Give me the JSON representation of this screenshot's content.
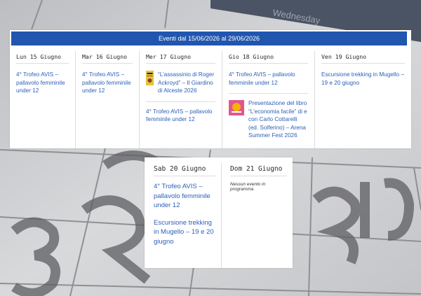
{
  "period": "Eventi dal 15/06/2026 al 29/06/2026",
  "background": {
    "weekday_text": "Wednesday"
  },
  "days": [
    {
      "label": "Lun 15 Giugno",
      "events": [
        {
          "title": "4° Trofeo AVIS – pallavolo femminile under 12"
        }
      ]
    },
    {
      "label": "Mar 16 Giugno",
      "events": [
        {
          "title": "4° Trofeo AVIS – pallavolo femminile under 12"
        }
      ]
    },
    {
      "label": "Mer 17 Giugno",
      "events": [
        {
          "title": "“L’assassinio di Roger Ackroyd” – Il Giardino di Alceste 2026",
          "thumbnail": "book-cover-icon"
        },
        {
          "title": "4° Trofeo AVIS – pallavolo femminile under 12"
        }
      ]
    },
    {
      "label": "Gio 18 Giugno",
      "events": [
        {
          "title": "4° Trofeo AVIS – pallavolo femminile under 12"
        },
        {
          "title": "Presentazione del libro “L’economia facile” di e con Carlo Cottarelli (ed. Solferino) – Arena Summer Fest 2026",
          "thumbnail": "book-cover-icon"
        }
      ]
    },
    {
      "label": "Ven 19 Giugno",
      "events": [
        {
          "title": "Escursione trekking in Mugello – 19 e 20 giugno"
        }
      ]
    },
    {
      "label": "Sab 20 Giugno",
      "events": [
        {
          "title": "4° Trofeo AVIS – pallavolo femminile under 12"
        },
        {
          "title": "Escursione trekking in Mugello – 19 e 20 giugno"
        }
      ]
    },
    {
      "label": "Dom 21 Giugno",
      "events": [],
      "empty_text": "Nessun evento in programma"
    }
  ],
  "colors": {
    "header_bar": "#2156ae",
    "link": "#2b5fb8",
    "panel": "#ffffff"
  }
}
